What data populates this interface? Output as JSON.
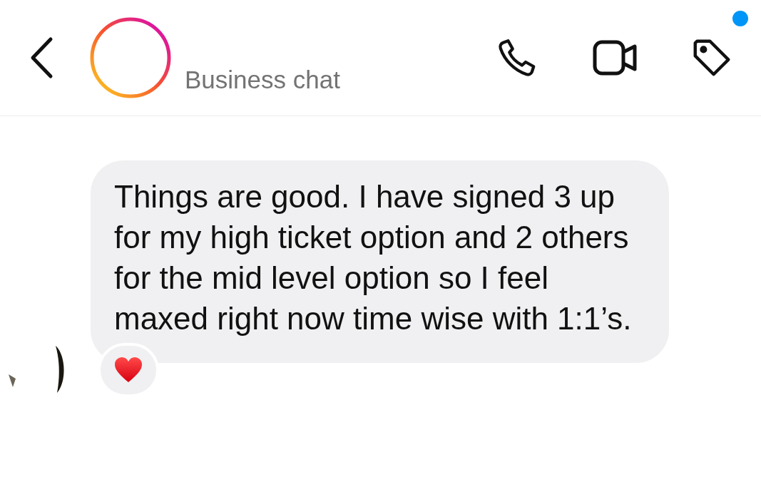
{
  "header": {
    "subtitle": "Business chat",
    "notification_dot": true
  },
  "messages": [
    {
      "text": "Things are good. I have signed 3 up for my high ticket option and 2 others for the mid level option so I feel maxed right now time wise with 1:1’s.",
      "reaction": {
        "kind": "heart"
      }
    }
  ]
}
